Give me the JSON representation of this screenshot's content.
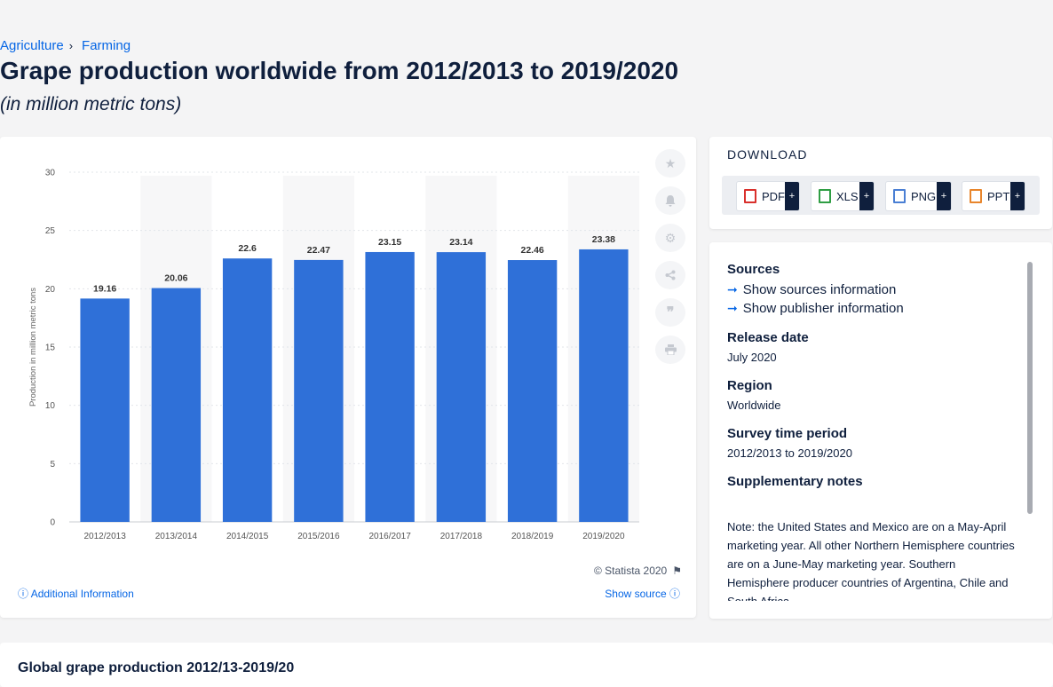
{
  "breadcrumb": {
    "items": [
      "Agriculture",
      "Farming"
    ],
    "separator": "›"
  },
  "page": {
    "title": "Grape production worldwide from 2012/2013 to 2019/2020",
    "subtitle": "(in million metric tons)"
  },
  "chart_data": {
    "type": "bar",
    "categories": [
      "2012/2013",
      "2013/2014",
      "2014/2015",
      "2015/2016",
      "2016/2017",
      "2017/2018",
      "2018/2019",
      "2019/2020"
    ],
    "values": [
      19.16,
      20.06,
      22.6,
      22.47,
      23.15,
      23.14,
      22.46,
      23.38
    ],
    "value_labels": [
      "19.16",
      "20.06",
      "22.6",
      "22.47",
      "23.15",
      "23.14",
      "22.46",
      "23.38"
    ],
    "ylabel": "Production in million metric tons",
    "xlabel": "",
    "ylim": [
      0,
      30
    ],
    "yticks": [
      0,
      5,
      10,
      15,
      20,
      25,
      30
    ],
    "grid": true,
    "bar_color": "#2f70d8"
  },
  "chart_card": {
    "copyright": "© Statista 2020",
    "additional_info": "Additional Information",
    "show_source": "Show source"
  },
  "tools": [
    "star-icon",
    "bell-icon",
    "gear-icon",
    "share-icon",
    "quote-icon",
    "print-icon"
  ],
  "download": {
    "heading": "DOWNLOAD",
    "buttons": [
      {
        "label": "PDF",
        "color": "#d9302c"
      },
      {
        "label": "XLS",
        "color": "#2f9e44"
      },
      {
        "label": "PNG",
        "color": "#4a7fd4"
      },
      {
        "label": "PPT",
        "color": "#e8852b"
      }
    ],
    "plus": "+"
  },
  "info": {
    "sources_label": "Sources",
    "show_sources": "Show sources information",
    "show_publisher": "Show publisher information",
    "release_label": "Release date",
    "release_value": "July 2020",
    "region_label": "Region",
    "region_value": "Worldwide",
    "survey_label": "Survey time period",
    "survey_value": "2012/2013 to 2019/2020",
    "supp_label": "Supplementary notes",
    "supp_text": "Note: the United States and Mexico are on a May-April marketing year. All other Northern Hemisphere countries are on a June-May marketing year. Southern Hemisphere producer countries of Argentina, Chile and South Africa"
  },
  "related": {
    "title": "Global grape production 2012/13-2019/20"
  }
}
